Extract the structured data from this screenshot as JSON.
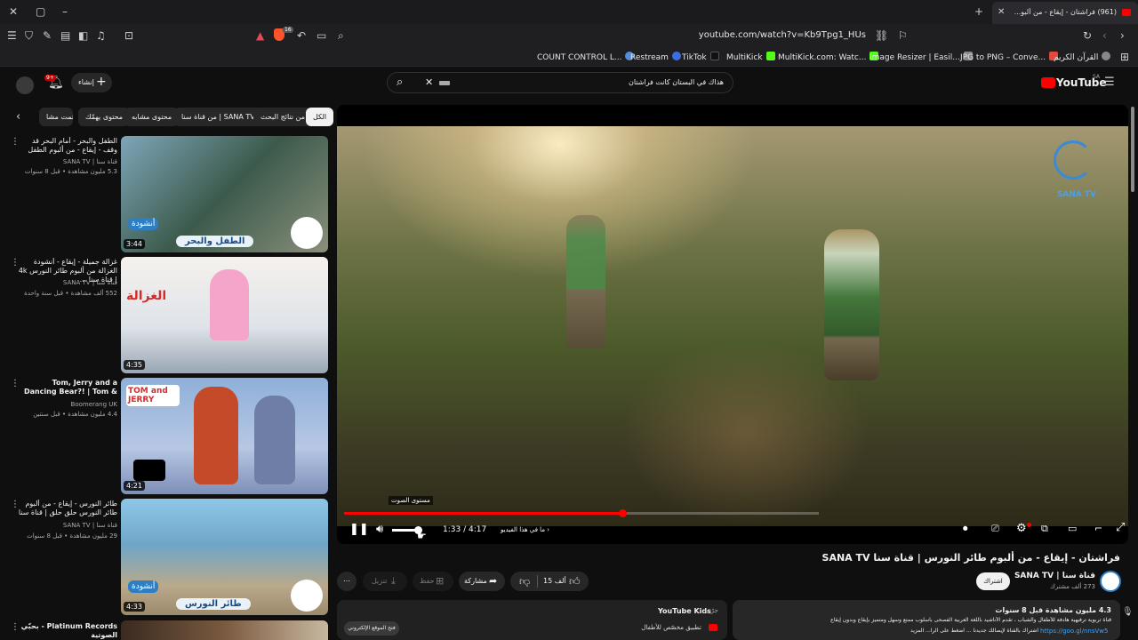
{
  "browser": {
    "tab_title": "(961) فراشتان - إيقاع - من ألبو...",
    "url": "youtube.com/watch?v=Kb9Tpg1_HUs",
    "shield_count": "16",
    "bookmarks": [
      {
        "label": "COUNT CONTROL L...",
        "color": "#4f8fdc"
      },
      {
        "label": "Restream",
        "color": "#3b6fe0"
      },
      {
        "label": "TikTok",
        "color": "#111111"
      },
      {
        "label": "MultiKick",
        "color": "#53fc18"
      },
      {
        "label": "MultiKick.com: Watc...",
        "color": "#53fc18"
      },
      {
        "label": "Image Resizer | Easil...",
        "color": "#888888"
      },
      {
        "label": "JPG to PNG – Conve...",
        "color": "#e04a3a"
      },
      {
        "label": "القرآن الكريم",
        "color": "#888888"
      }
    ]
  },
  "header": {
    "search_query": "هذاك في البستان كانت فراشتان",
    "logo": "YouTube",
    "region": "SA",
    "create_label": "إنشاء",
    "notif_count": "9+"
  },
  "chips": [
    "الكل",
    "من نتائج البحث",
    "من قناة سنا | SANA TV",
    "محتوى مشابه",
    "محتوى يهمّك",
    "تمت مشا..."
  ],
  "sidebar_videos": [
    {
      "title": "الطفل والبحر - أمام البحر قد وقف - إيقاع - من ألبوم الطفل والبحر | قناة سن...",
      "channel": "قناة سنا | SANA TV",
      "meta": "5.3 مليون مشاهدة • قبل 8 سنوات",
      "duration": "3:44",
      "thumb_caption": "الطفل والبحر",
      "badge": "أنشودة"
    },
    {
      "title": "غزالة جميلة - إيقاع - أنشودة الغزالة من ألبوم طائر النورس 4k | قناة سنا ...",
      "channel": "قناة سنا | SANA TV",
      "meta": "552 ألف مشاهدة • قبل سنة واحدة",
      "duration": "4:35",
      "thumb_caption": "الغزالة"
    },
    {
      "title": "Tom, Jerry and a Dancing Bear?! | Tom & Jerry | ...",
      "channel": "Boomerang UK",
      "meta": "4.4 مليون مشاهدة • قبل سنتين",
      "duration": "4:21",
      "thumb_caption": "TOM and JERRY"
    },
    {
      "title": "طائر النورس - إيقاع - من ألبوم طائر النورس حلق حلق | قناة سنا SANA ...",
      "channel": "قناة سنا | SANA TV",
      "meta": "29 مليون مشاهدة • قبل 8 سنوات",
      "duration": "4:33",
      "thumb_caption": "طائر النورس",
      "badge": "أنشودة"
    },
    {
      "title": "Platinum Records - بحبّي الصوتية",
      "channel": "",
      "meta": "",
      "duration": "",
      "thumb_caption": ""
    }
  ],
  "player": {
    "watermark": "SANA TV",
    "volume_tooltip": "مستوى الصوت",
    "time": "1:33 / 4:17",
    "chapter": "ما في هذا الفيديو",
    "progress": 0.586
  },
  "video": {
    "title": "فراشتان - إيقاع - من ألبوم طائر النورس | قناة سنا SANA TV",
    "channel": "قناة سنا | SANA TV",
    "subscribers": "273 ألف مشترك",
    "subscribe_label": "اشتراك",
    "likes": "15 ألف",
    "share_label": "مشاركة",
    "save_label": "حفظ",
    "download_label": "تنزيل",
    "views_date": "4.3 مليون مشاهدة  قبل 8 سنوات",
    "desc_line1": "قناة تربوية ترفيهية هادفة للأطفال والشباب ، تقدم الأناشيد باللغة العربية الفصحى بأسلوب ممتع وسهل ومتميز بإيقاع وبدون إيقاع",
    "desc_line2": "اشتراك بالقناة لإيصالك جديدنا ... اضغط على الرا... المزيد",
    "desc_link": "https://goo.gl/nnsVw5"
  },
  "kids_card": {
    "title": "YouTube Kids",
    "tag": "جرّب",
    "subtitle": "تطبيق مخصّص للأطفال",
    "button": "فتح الموقع الإلكتروني"
  }
}
